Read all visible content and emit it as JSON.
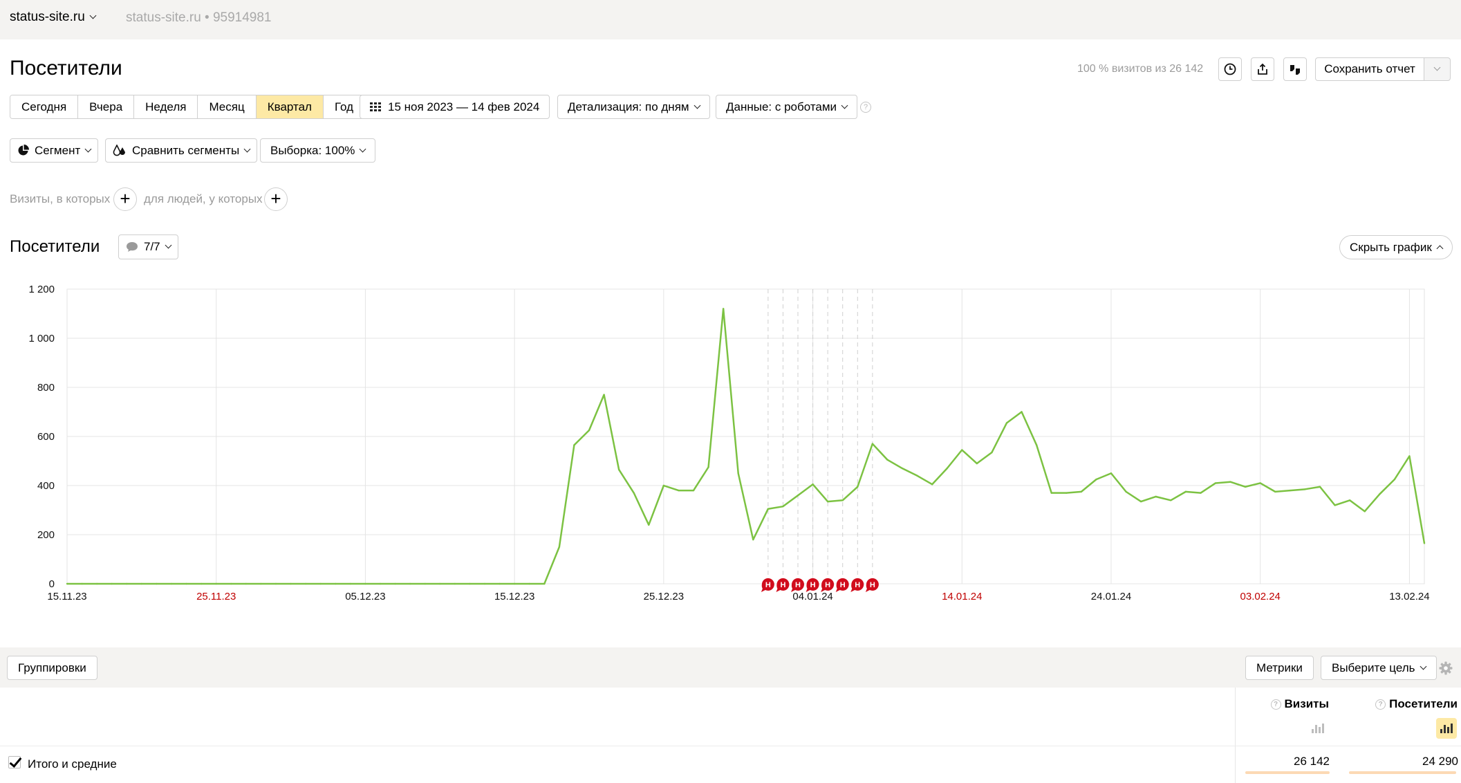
{
  "header": {
    "site": "status-site.ru",
    "site_meta": "status-site.ru • 95914981"
  },
  "report": {
    "title": "Посетители",
    "visits_share": "100 % визитов из 26 142",
    "save_label": "Сохранить отчет"
  },
  "periods": [
    {
      "label": "Сегодня",
      "active": false
    },
    {
      "label": "Вчера",
      "active": false
    },
    {
      "label": "Неделя",
      "active": false
    },
    {
      "label": "Месяц",
      "active": false
    },
    {
      "label": "Квартал",
      "active": true
    },
    {
      "label": "Год",
      "active": false
    }
  ],
  "controls": {
    "date_range": "15 ноя 2023 — 14 фев 2024",
    "detail": "Детализация: по дням",
    "data": "Данные: с роботами",
    "help": "?",
    "segment": "Сегмент",
    "compare": "Сравнить сегменты",
    "sample": "Выборка: 100%"
  },
  "filters": {
    "visits_text": "Визиты, в которых",
    "people_text": "для людей, у которых",
    "add": "+"
  },
  "chart_section": {
    "title": "Посетители",
    "notes_count": "7/7",
    "hide_label": "Скрыть график"
  },
  "chart_data": {
    "type": "line",
    "title": "",
    "xlabel": "",
    "ylabel": "",
    "ylim": [
      0,
      1200
    ],
    "yticks": [
      "0",
      "200",
      "400",
      "600",
      "800",
      "1 000",
      "1 200"
    ],
    "ytick_values": [
      0,
      200,
      400,
      600,
      800,
      1000,
      1200
    ],
    "xticks": [
      {
        "label": "15.11.23",
        "day": 0,
        "weekend": false
      },
      {
        "label": "25.11.23",
        "day": 10,
        "weekend": true
      },
      {
        "label": "05.12.23",
        "day": 20,
        "weekend": false
      },
      {
        "label": "15.12.23",
        "day": 30,
        "weekend": false
      },
      {
        "label": "25.12.23",
        "day": 40,
        "weekend": false
      },
      {
        "label": "04.01.24",
        "day": 50,
        "weekend": false
      },
      {
        "label": "14.01.24",
        "day": 60,
        "weekend": true
      },
      {
        "label": "24.01.24",
        "day": 70,
        "weekend": false
      },
      {
        "label": "03.02.24",
        "day": 80,
        "weekend": true
      },
      {
        "label": "13.02.24",
        "day": 90,
        "weekend": false
      }
    ],
    "x_range_days": [
      0,
      91
    ],
    "series": [
      {
        "name": "Посетители",
        "color": "#7cc242",
        "values": [
          0,
          0,
          0,
          0,
          0,
          0,
          0,
          0,
          0,
          0,
          0,
          0,
          0,
          0,
          0,
          0,
          0,
          0,
          0,
          0,
          0,
          0,
          0,
          0,
          0,
          0,
          0,
          0,
          0,
          0,
          0,
          0,
          0,
          150,
          565,
          625,
          770,
          465,
          370,
          240,
          400,
          380,
          380,
          475,
          1120,
          450,
          180,
          305,
          315,
          360,
          405,
          335,
          340,
          395,
          570,
          505,
          470,
          440,
          405,
          470,
          545,
          490,
          535,
          655,
          700,
          565,
          370,
          370,
          375,
          425,
          450,
          375,
          335,
          355,
          340,
          375,
          370,
          410,
          415,
          395,
          410,
          375,
          380,
          385,
          395,
          320,
          340,
          295,
          365,
          425,
          520,
          165
        ]
      }
    ],
    "annotations": [
      {
        "day": 47,
        "label": "Н"
      },
      {
        "day": 48,
        "label": "Н"
      },
      {
        "day": 49,
        "label": "Н"
      },
      {
        "day": 50,
        "label": "Н"
      },
      {
        "day": 51,
        "label": "Н"
      },
      {
        "day": 52,
        "label": "Н"
      },
      {
        "day": 53,
        "label": "Н"
      },
      {
        "day": 54,
        "label": "Н"
      }
    ],
    "grid": true,
    "legend": "none"
  },
  "table": {
    "groupings_label": "Группировки",
    "metrics_label": "Метрики",
    "goal_label": "Выберите цель",
    "columns": [
      {
        "label": "Визиты",
        "total": "26 142",
        "chart_on": false
      },
      {
        "label": "Посетители",
        "total": "24 290",
        "chart_on": true
      }
    ],
    "total_row_label": "Итого и средние"
  },
  "colors": {
    "accent_yellow": "#fde9a5",
    "line_green": "#7cc242",
    "weekend_red": "#c00000",
    "annotation_red": "#d10c1c"
  }
}
